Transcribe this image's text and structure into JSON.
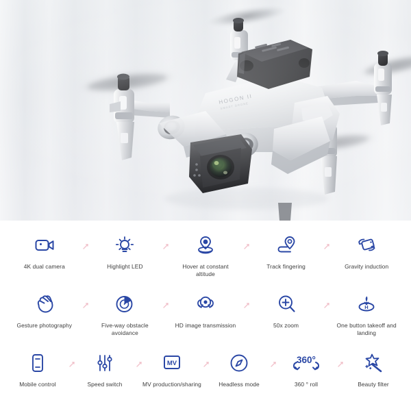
{
  "product": {
    "brand_text": "HOGON",
    "sub_text": "SMART DRONE",
    "alt": "White quadcopter drone in flight with spinning propellers and gimbal camera"
  },
  "colors": {
    "icon_blue": "#2a47a5",
    "label_gray": "#3c3c3c",
    "tick_pink": "#e0768a",
    "photo_bg_light": "#ececef",
    "photo_bg_dark": "#e2e5e9",
    "drone_body": "#e9eaec",
    "drone_dark": "#2f3034",
    "page_bg": "#ffffff"
  },
  "features": {
    "rows": [
      [
        {
          "icon": "video-camera-icon",
          "label": "4K dual camera"
        },
        {
          "icon": "lightbulb-icon",
          "label": "Highlight LED"
        },
        {
          "icon": "hover-altitude-icon",
          "label": "Hover at constant altitude"
        },
        {
          "icon": "track-pin-path-icon",
          "label": "Track fingering"
        },
        {
          "icon": "gravity-tilt-phone-icon",
          "label": "Gravity induction"
        }
      ],
      [
        {
          "icon": "hand-gesture-icon",
          "label": "Gesture photography"
        },
        {
          "icon": "obstacle-radar-icon",
          "label": "Five-way obstacle avoidance"
        },
        {
          "icon": "hd-transmission-icon",
          "label": "HD image transmission"
        },
        {
          "icon": "zoom-magnifier-icon",
          "label": "50x zoom"
        },
        {
          "icon": "takeoff-landing-icon",
          "label": "One button takeoff and landing"
        }
      ],
      [
        {
          "icon": "mobile-phone-icon",
          "label": "Mobile control"
        },
        {
          "icon": "sliders-speed-icon",
          "label": "Speed switch"
        },
        {
          "icon": "mv-badge-icon",
          "label": "MV production/sharing"
        },
        {
          "icon": "compass-icon",
          "label": "Headless mode"
        },
        {
          "icon": "roll-360-icon",
          "label": "360 ° roll"
        },
        {
          "icon": "magic-wand-star-icon",
          "label": "Beauty filter"
        }
      ]
    ],
    "separator_glyph": "diagonal-tick-icon"
  }
}
